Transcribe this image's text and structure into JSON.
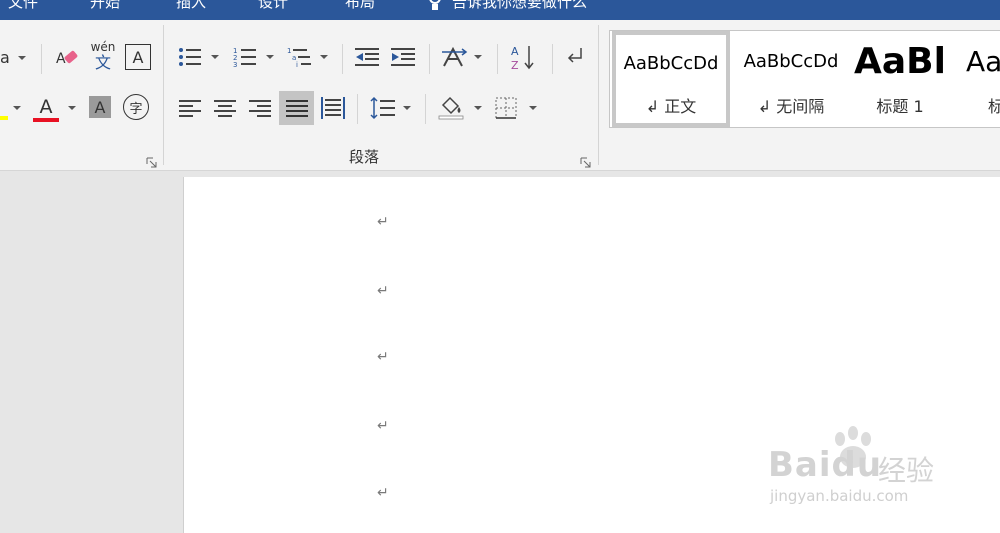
{
  "titlebar": {
    "tabs": [
      "文件",
      "开始",
      "插入",
      "设计",
      "布局"
    ],
    "tell_me": "告诉我你想要做什么"
  },
  "font_group": {
    "font_size_fragment": "a",
    "phonetic_label": "wén",
    "phonetic_char": "文",
    "font_color_letter": "A",
    "char_shading_letter": "A",
    "enclose_char": "字",
    "border_letter": "A",
    "colors": {
      "font_color": "#e81123",
      "highlight": "#ffff00"
    }
  },
  "paragraph_group": {
    "label": "段落"
  },
  "styles_gallery": {
    "items": [
      {
        "sample": "AaBbCcDd",
        "label": "↲ 正文",
        "selected": true
      },
      {
        "sample": "AaBbCcDd",
        "label": "↲ 无间隔",
        "selected": false
      },
      {
        "sample": "AaBl",
        "label": "标题 1",
        "selected": false
      },
      {
        "sample": "Aa",
        "label": "标",
        "selected": false
      }
    ]
  },
  "document": {
    "paragraph_mark": "↵",
    "paragraph_count": 5
  },
  "watermark": {
    "brand": "Baidu",
    "suffix": "经验",
    "url": "jingyan.baidu.com"
  }
}
